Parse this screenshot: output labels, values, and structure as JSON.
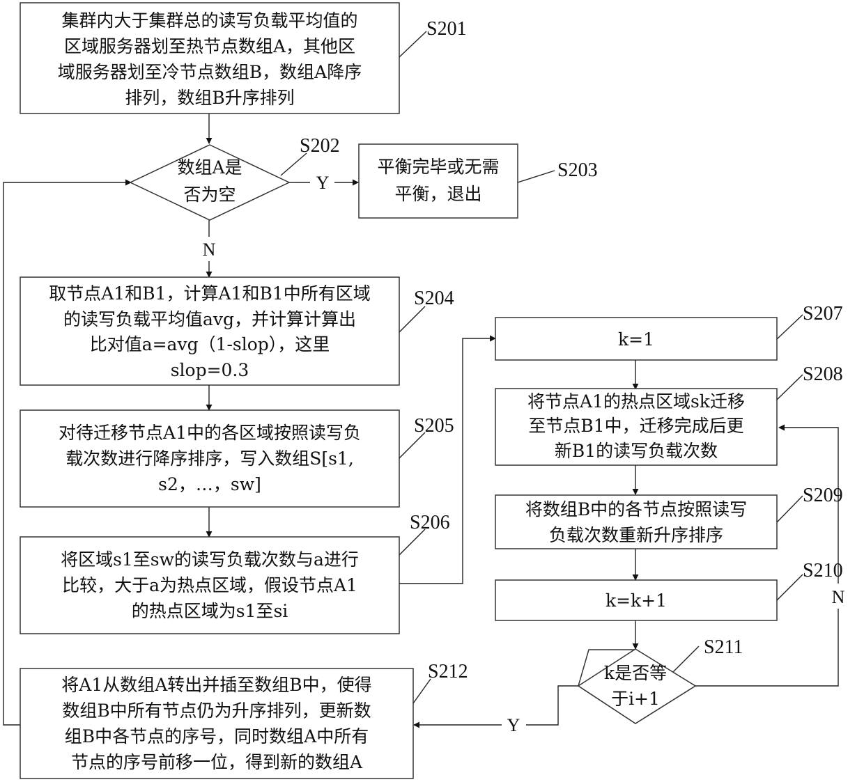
{
  "steps": {
    "s201": {
      "label": "S201",
      "lines": [
        "集群内大于集群总的读写负载平均值的",
        "区域服务器划至热节点数组A，其他区",
        "域服务器划至冷节点数组B，数组A降序",
        "排列，数组B升序排列"
      ]
    },
    "s202": {
      "label": "S202",
      "lines": [
        "数组A是",
        "否为空"
      ]
    },
    "s203": {
      "label": "S203",
      "lines": [
        "平衡完毕或无需",
        "平衡，退出"
      ]
    },
    "s204": {
      "label": "S204",
      "lines": [
        "取节点A1和B1，计算A1和B1中所有区域",
        "的读写负载平均值avg，并计算计算出",
        "比对值a=avg（1-slop），这里",
        "slop=0.3"
      ]
    },
    "s205": {
      "label": "S205",
      "lines": [
        "对待迁移节点A1中的各区域按照读写负",
        "载次数进行降序排序，写入数组S[s1,",
        "s2，…，sw]"
      ]
    },
    "s206": {
      "label": "S206",
      "lines": [
        "将区域s1至sw的读写负载次数与a进行",
        "比较，大于a为热点区域，假设节点A1",
        "的热点区域为s1至si"
      ]
    },
    "s207": {
      "label": "S207",
      "lines": [
        "k=1"
      ]
    },
    "s208": {
      "label": "S208",
      "lines": [
        "将节点A1的热点区域sk迁移",
        "至节点B1中，迁移完成后更",
        "新B1的读写负载次数"
      ]
    },
    "s209": {
      "label": "S209",
      "lines": [
        "将数组B中的各节点按照读写",
        "负载次数重新升序排序"
      ]
    },
    "s210": {
      "label": "S210",
      "lines": [
        "k=k+1"
      ]
    },
    "s211": {
      "label": "S211",
      "lines": [
        "k是否等",
        "于i+1"
      ]
    },
    "s212": {
      "label": "S212",
      "lines": [
        "将A1从数组A转出并插至数组B中，使得",
        "数组B中所有节点仍为升序排列，更新数",
        "组B中各节点的序号，同时数组A中所有",
        "节点的序号前移一位，得到新的数组A"
      ]
    }
  },
  "edge_labels": {
    "s202_yes": "Y",
    "s202_no": "N",
    "s211_yes": "Y",
    "s211_no": "N"
  }
}
